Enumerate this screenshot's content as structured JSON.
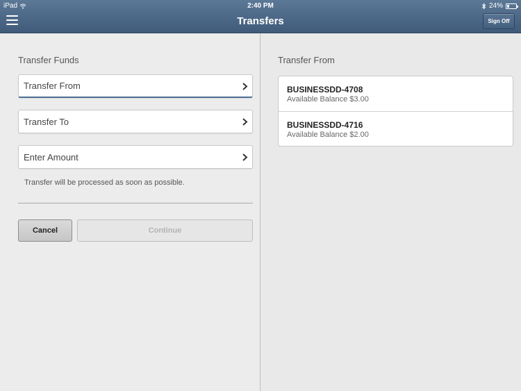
{
  "status_bar": {
    "device": "iPad",
    "time": "2:40 PM",
    "battery": "24%"
  },
  "nav": {
    "title": "Transfers",
    "sign_off": "Sign Off"
  },
  "form": {
    "section_title": "Transfer Funds",
    "transfer_from_label": "Transfer From",
    "transfer_to_label": "Transfer To",
    "amount_label": "Enter Amount",
    "note": "Transfer will be processed as soon as possible.",
    "cancel_label": "Cancel",
    "continue_label": "Continue"
  },
  "accounts_panel": {
    "title": "Transfer From",
    "accounts": [
      {
        "name": "BUSINESSDD-4708",
        "balance": "Available Balance  $3.00"
      },
      {
        "name": "BUSINESSDD-4716",
        "balance": "Available Balance  $2.00"
      }
    ]
  },
  "colors": {
    "nav_bar": "#4d6887",
    "selected_accent": "#4a6f94"
  },
  "icons": {
    "menu": "hamburger-icon",
    "chevron": "chevron-right-icon",
    "wifi": "wifi-icon",
    "bluetooth": "bluetooth-icon",
    "battery": "battery-icon"
  }
}
